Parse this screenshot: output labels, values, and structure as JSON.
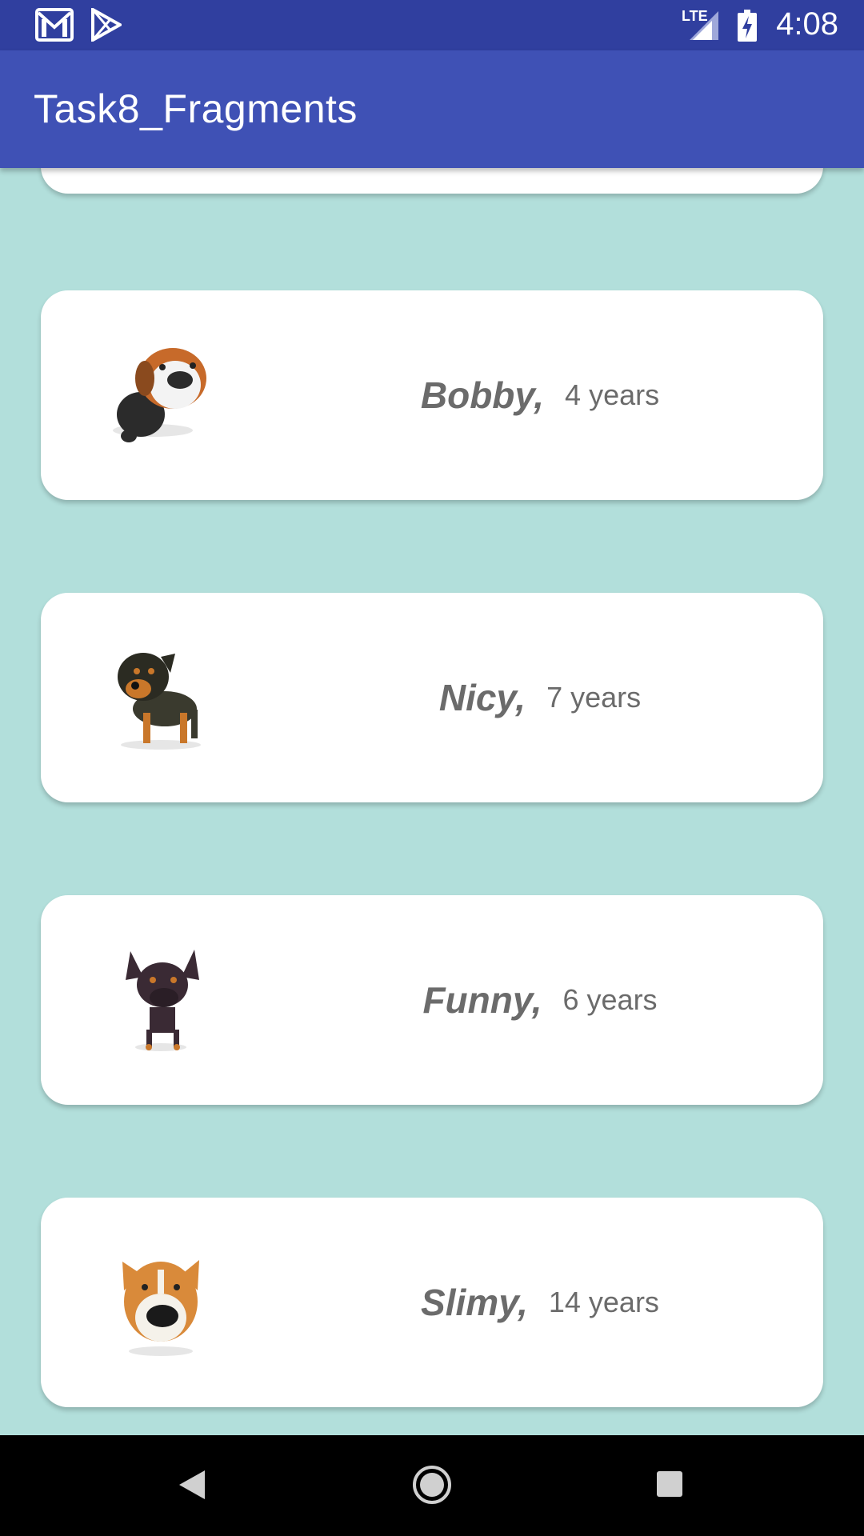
{
  "status_bar": {
    "time": "4:08",
    "network_label": "LTE",
    "left_icons": [
      "gmail-icon",
      "play-store-icon"
    ],
    "right_icons": [
      "lte-signal-icon",
      "battery-charging-icon"
    ]
  },
  "app_bar": {
    "title": "Task8_Fragments"
  },
  "dogs": [
    {
      "name": "Bobby,",
      "age": "4 years",
      "icon": "dog-beagle-icon"
    },
    {
      "name": "Nicy,",
      "age": "7 years",
      "icon": "dog-dachshund-icon"
    },
    {
      "name": "Funny,",
      "age": "6 years",
      "icon": "dog-pinscher-icon"
    },
    {
      "name": "Slimy,",
      "age": "14 years",
      "icon": "dog-corgi-icon"
    }
  ],
  "nav_bar": {
    "buttons": [
      "back-icon",
      "home-icon",
      "recents-icon"
    ]
  },
  "colors": {
    "status_bar": "#303f9f",
    "app_bar": "#3f51b5",
    "background": "#b2dfdb",
    "card": "#ffffff",
    "card_text": "#6b6b6b"
  }
}
